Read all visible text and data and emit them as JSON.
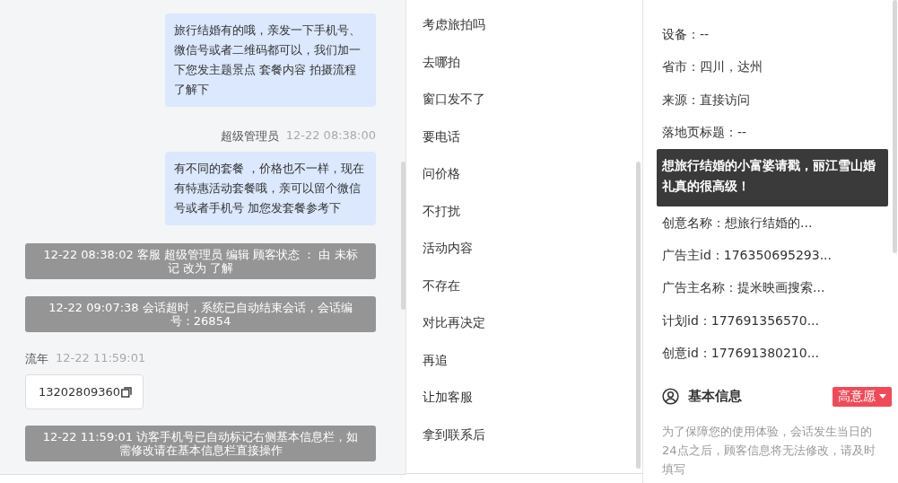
{
  "chat": {
    "messages": [
      {
        "kind": "agent_bubble",
        "text": "旅行结婚有的哦，亲发一下手机号、微信号或者二维码都可以，我们加一下您发主题景点 套餐内容 拍摄流程了解下"
      },
      {
        "kind": "agent_bubble",
        "sender": "超级管理员",
        "time": "12-22 08:38:00",
        "text": "有不同的套餐 ，价格也不一样，现在有特惠活动套餐哦，亲可以留个微信号或者手机号 加您发套餐参考下"
      },
      {
        "kind": "system",
        "text": "12-22 08:38:02 客服 超级管理员 编辑 顾客状态 ： 由 未标记 改为 了解"
      },
      {
        "kind": "system",
        "text": "12-22 09:07:38 会话超时，系统已自动结束会话，会话编号：26854"
      },
      {
        "kind": "visitor_phone",
        "sender": "流年",
        "time": "12-22 11:59:01",
        "text": "13202809360"
      },
      {
        "kind": "system",
        "text": "12-22 11:59:01 访客手机号已自动标记右侧基本信息栏，如需修改请在基本信息栏直接操作"
      }
    ]
  },
  "quick_replies": [
    "考虑旅拍吗",
    "去哪拍",
    "窗口发不了",
    "要电话",
    "问价格",
    "不打扰",
    "活动内容",
    "不存在",
    "对比再决定",
    "再追",
    "让加客服",
    "拿到联系后"
  ],
  "source_info": {
    "fields": [
      {
        "label": "设备：",
        "value": "--"
      },
      {
        "label": "省市：",
        "value": "四川，达州"
      },
      {
        "label": "来源：",
        "value": "直接访问"
      },
      {
        "label": "落地页标题：",
        "value": "--"
      },
      {
        "label": "创意名称：",
        "value": "想旅行结婚的..."
      },
      {
        "label": "广告主id：",
        "value": "176350695293..."
      },
      {
        "label": "广告主名称：",
        "value": "提米映画搜索..."
      },
      {
        "label": "计划id：",
        "value": "177691356570..."
      },
      {
        "label": "创意id：",
        "value": "177691380210..."
      }
    ],
    "tooltip": "想旅行结婚的小富婆请戳，丽江雪山婚礼真的很高级！"
  },
  "basic_info": {
    "title": "基本信息",
    "intent_tag": "高意愿",
    "notice": "为了保障您的使用体验，会话发生当日的24点之后，顾客信息将无法修改，请及时填写"
  }
}
